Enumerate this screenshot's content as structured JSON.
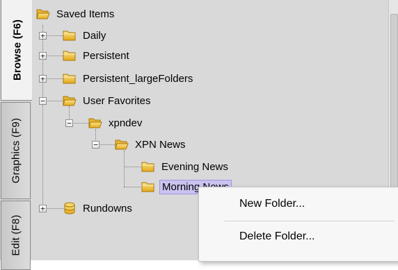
{
  "tabs": [
    {
      "label": "Browse (F6)",
      "active": true
    },
    {
      "label": "Graphics (F9)",
      "active": false
    },
    {
      "label": "Edit (F8)",
      "active": false
    }
  ],
  "tree": {
    "root": "Saved Items",
    "daily": "Daily",
    "persistent": "Persistent",
    "persistent_large": "Persistent_largeFolders",
    "user_favorites": "User Favorites",
    "xpndev": "xpndev",
    "xpn_news": "XPN News",
    "evening_news": "Evening News",
    "morning_news": "Morning News",
    "rundowns": "Rundowns"
  },
  "context_menu": {
    "new_folder": "New Folder...",
    "delete_folder": "Delete Folder..."
  },
  "icons": {
    "folder": "folder-icon",
    "folder_open": "folder-open-icon",
    "database": "database-icon",
    "expand": "+",
    "collapse": "−"
  },
  "colors": {
    "folder": "#f2c94c",
    "selection": "#c9c3f0",
    "pane": "#d9d9d9"
  }
}
